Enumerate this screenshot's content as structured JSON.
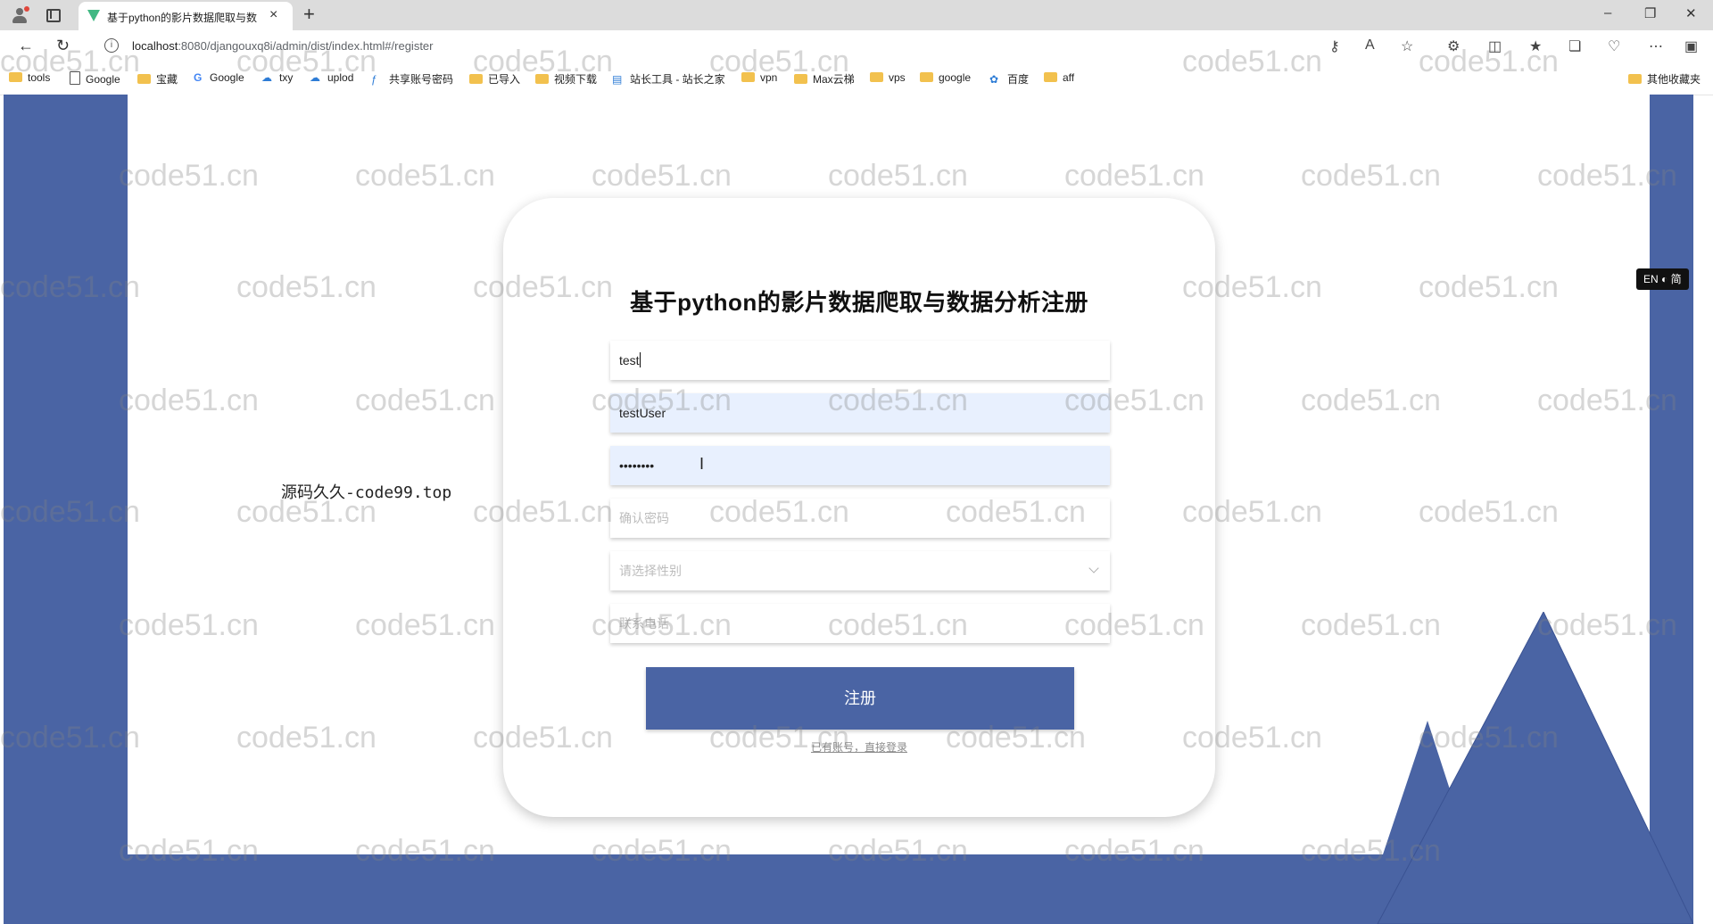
{
  "browser": {
    "tab_title": "基于python的影片数据爬取与数据...",
    "tab_close": "×",
    "new_tab": "+",
    "url_host": "localhost",
    "url_rest": ":8080/djangouxq8i/admin/dist/index.html#/register",
    "minimize": "–",
    "restore": "❐",
    "close": "✕",
    "bookmarks": [
      "tools",
      "Google",
      "宝藏",
      "Google",
      "txy",
      "uplod",
      "共享账号密码",
      "已导入",
      "视频下载",
      "站长工具 - 站长之家",
      "vpn",
      "Max云梯",
      "vps",
      "google",
      "百度",
      "aff"
    ],
    "other_bookmarks": "其他收藏夹"
  },
  "form": {
    "title": "基于python的影片数据爬取与数据分析注册",
    "username_value": "test",
    "name_value": "testUser",
    "password_value": "••••••••",
    "confirm_password_placeholder": "确认密码",
    "gender_placeholder": "请选择性别",
    "phone_placeholder": "联系电话",
    "register_label": "注册",
    "login_link": "已有账号，直接登录"
  },
  "overlay_text": "源码久久-code99.top",
  "lang_badge": "EN ◐ 简",
  "watermark": "code51.cn",
  "colors": {
    "accent": "#4a64a4",
    "autofill": "#e8f0fe"
  }
}
